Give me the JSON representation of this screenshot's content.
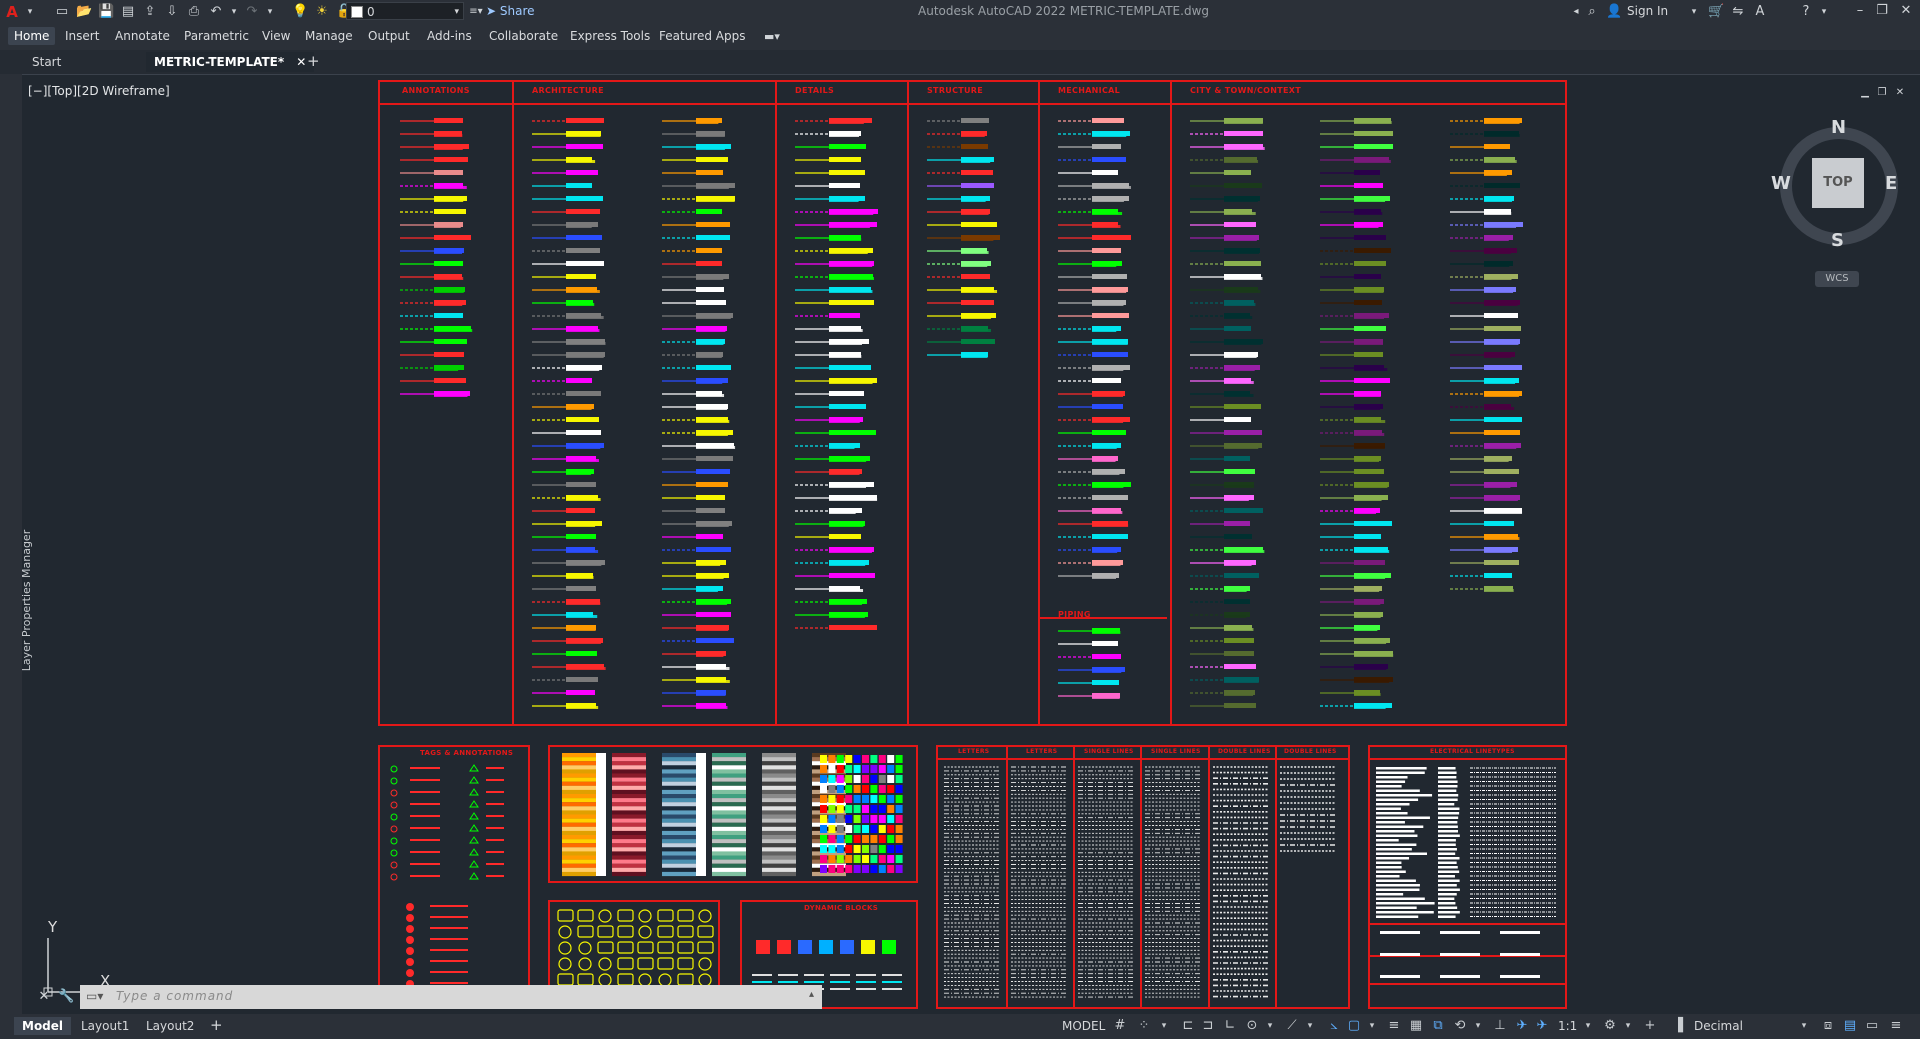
{
  "titlebar": {
    "layer_value": "0",
    "share_label": "Share",
    "window_title": "Autodesk AutoCAD 2022   METRIC-TEMPLATE.dwg",
    "signin_label": "Sign In"
  },
  "menu": {
    "items": [
      "Home",
      "Insert",
      "Annotate",
      "Parametric",
      "View",
      "Manage",
      "Output",
      "Add-ins",
      "Collaborate",
      "Express Tools",
      "Featured Apps"
    ]
  },
  "tabs": {
    "start": "Start",
    "file": "METRIC-TEMPLATE*",
    "add": "+"
  },
  "viewport_label": "[−][Top][2D Wireframe]",
  "left_palette": "Layer Properties Manager",
  "viewcube": {
    "top": "TOP",
    "n": "N",
    "s": "S",
    "w": "W",
    "e": "E",
    "wcs": "WCS"
  },
  "drawing": {
    "layer_columns": [
      "ANNOTATIONS",
      "ARCHITECTURE",
      "DETAILS",
      "STRUCTURE",
      "MECHANICAL",
      "CITY & TOWN/CONTEXT"
    ],
    "piping_label": "PIPING",
    "lower_panels": {
      "tags": "TAGS & ANNOTATIONS",
      "dynamic": "DYNAMIC BLOCKS",
      "lines": [
        "LETTERS",
        "LETTERS",
        "SINGLE LINES",
        "SINGLE LINES",
        "DOUBLE LINES",
        "DOUBLE LINES"
      ],
      "electrical": "ELECTRICAL LINETYPES"
    },
    "colors": {
      "frame": "#e31818",
      "background": "#212830"
    }
  },
  "ucs": {
    "y": "Y",
    "x": "X"
  },
  "command": {
    "placeholder": "Type a command"
  },
  "status": {
    "tabs": [
      "Model",
      "Layout1",
      "Layout2",
      "+"
    ],
    "model_label": "MODEL",
    "scale": "1:1",
    "units": "Decimal"
  }
}
